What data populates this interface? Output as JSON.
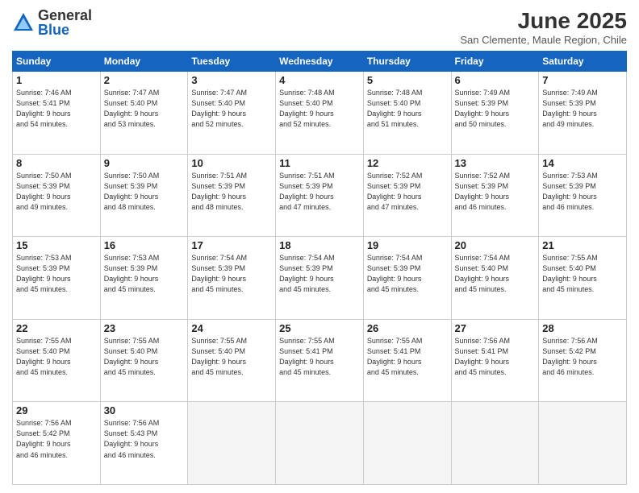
{
  "logo": {
    "general": "General",
    "blue": "Blue"
  },
  "title": "June 2025",
  "location": "San Clemente, Maule Region, Chile",
  "days_header": [
    "Sunday",
    "Monday",
    "Tuesday",
    "Wednesday",
    "Thursday",
    "Friday",
    "Saturday"
  ],
  "weeks": [
    [
      {
        "day": "1",
        "info": "Sunrise: 7:46 AM\nSunset: 5:41 PM\nDaylight: 9 hours\nand 54 minutes."
      },
      {
        "day": "2",
        "info": "Sunrise: 7:47 AM\nSunset: 5:40 PM\nDaylight: 9 hours\nand 53 minutes."
      },
      {
        "day": "3",
        "info": "Sunrise: 7:47 AM\nSunset: 5:40 PM\nDaylight: 9 hours\nand 52 minutes."
      },
      {
        "day": "4",
        "info": "Sunrise: 7:48 AM\nSunset: 5:40 PM\nDaylight: 9 hours\nand 52 minutes."
      },
      {
        "day": "5",
        "info": "Sunrise: 7:48 AM\nSunset: 5:40 PM\nDaylight: 9 hours\nand 51 minutes."
      },
      {
        "day": "6",
        "info": "Sunrise: 7:49 AM\nSunset: 5:39 PM\nDaylight: 9 hours\nand 50 minutes."
      },
      {
        "day": "7",
        "info": "Sunrise: 7:49 AM\nSunset: 5:39 PM\nDaylight: 9 hours\nand 49 minutes."
      }
    ],
    [
      {
        "day": "8",
        "info": "Sunrise: 7:50 AM\nSunset: 5:39 PM\nDaylight: 9 hours\nand 49 minutes."
      },
      {
        "day": "9",
        "info": "Sunrise: 7:50 AM\nSunset: 5:39 PM\nDaylight: 9 hours\nand 48 minutes."
      },
      {
        "day": "10",
        "info": "Sunrise: 7:51 AM\nSunset: 5:39 PM\nDaylight: 9 hours\nand 48 minutes."
      },
      {
        "day": "11",
        "info": "Sunrise: 7:51 AM\nSunset: 5:39 PM\nDaylight: 9 hours\nand 47 minutes."
      },
      {
        "day": "12",
        "info": "Sunrise: 7:52 AM\nSunset: 5:39 PM\nDaylight: 9 hours\nand 47 minutes."
      },
      {
        "day": "13",
        "info": "Sunrise: 7:52 AM\nSunset: 5:39 PM\nDaylight: 9 hours\nand 46 minutes."
      },
      {
        "day": "14",
        "info": "Sunrise: 7:53 AM\nSunset: 5:39 PM\nDaylight: 9 hours\nand 46 minutes."
      }
    ],
    [
      {
        "day": "15",
        "info": "Sunrise: 7:53 AM\nSunset: 5:39 PM\nDaylight: 9 hours\nand 45 minutes."
      },
      {
        "day": "16",
        "info": "Sunrise: 7:53 AM\nSunset: 5:39 PM\nDaylight: 9 hours\nand 45 minutes."
      },
      {
        "day": "17",
        "info": "Sunrise: 7:54 AM\nSunset: 5:39 PM\nDaylight: 9 hours\nand 45 minutes."
      },
      {
        "day": "18",
        "info": "Sunrise: 7:54 AM\nSunset: 5:39 PM\nDaylight: 9 hours\nand 45 minutes."
      },
      {
        "day": "19",
        "info": "Sunrise: 7:54 AM\nSunset: 5:39 PM\nDaylight: 9 hours\nand 45 minutes."
      },
      {
        "day": "20",
        "info": "Sunrise: 7:54 AM\nSunset: 5:40 PM\nDaylight: 9 hours\nand 45 minutes."
      },
      {
        "day": "21",
        "info": "Sunrise: 7:55 AM\nSunset: 5:40 PM\nDaylight: 9 hours\nand 45 minutes."
      }
    ],
    [
      {
        "day": "22",
        "info": "Sunrise: 7:55 AM\nSunset: 5:40 PM\nDaylight: 9 hours\nand 45 minutes."
      },
      {
        "day": "23",
        "info": "Sunrise: 7:55 AM\nSunset: 5:40 PM\nDaylight: 9 hours\nand 45 minutes."
      },
      {
        "day": "24",
        "info": "Sunrise: 7:55 AM\nSunset: 5:40 PM\nDaylight: 9 hours\nand 45 minutes."
      },
      {
        "day": "25",
        "info": "Sunrise: 7:55 AM\nSunset: 5:41 PM\nDaylight: 9 hours\nand 45 minutes."
      },
      {
        "day": "26",
        "info": "Sunrise: 7:55 AM\nSunset: 5:41 PM\nDaylight: 9 hours\nand 45 minutes."
      },
      {
        "day": "27",
        "info": "Sunrise: 7:56 AM\nSunset: 5:41 PM\nDaylight: 9 hours\nand 45 minutes."
      },
      {
        "day": "28",
        "info": "Sunrise: 7:56 AM\nSunset: 5:42 PM\nDaylight: 9 hours\nand 46 minutes."
      }
    ],
    [
      {
        "day": "29",
        "info": "Sunrise: 7:56 AM\nSunset: 5:42 PM\nDaylight: 9 hours\nand 46 minutes."
      },
      {
        "day": "30",
        "info": "Sunrise: 7:56 AM\nSunset: 5:43 PM\nDaylight: 9 hours\nand 46 minutes."
      },
      {
        "day": "",
        "info": ""
      },
      {
        "day": "",
        "info": ""
      },
      {
        "day": "",
        "info": ""
      },
      {
        "day": "",
        "info": ""
      },
      {
        "day": "",
        "info": ""
      }
    ]
  ]
}
